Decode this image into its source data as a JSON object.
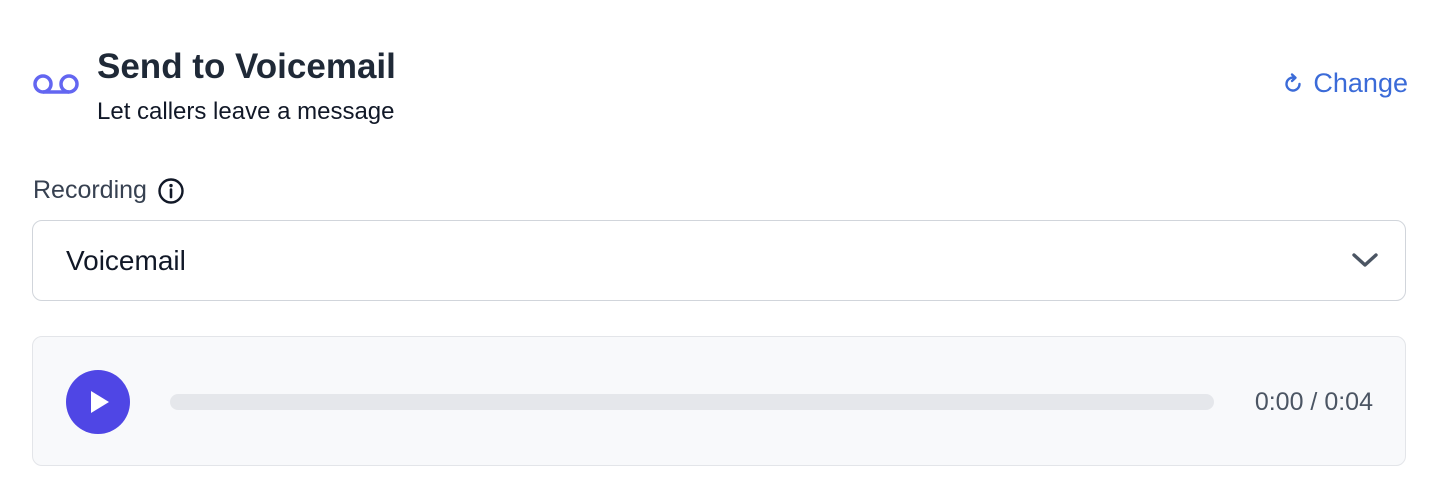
{
  "header": {
    "icon": "voicemail-icon",
    "title": "Send to Voicemail",
    "subtitle": "Let callers leave a message",
    "change_label": "Change",
    "change_icon": "refresh-icon"
  },
  "recording": {
    "label": "Recording",
    "info_icon": "info-icon",
    "selected": "Voicemail",
    "chevron_icon": "chevron-down-icon"
  },
  "player": {
    "play_icon": "play-icon",
    "progress": 0,
    "current_time": "0:00",
    "duration": "0:04",
    "time_separator": " / "
  },
  "colors": {
    "accent": "#4f46e5",
    "link": "#3b6bd8",
    "icon_purple": "#6366f1"
  }
}
